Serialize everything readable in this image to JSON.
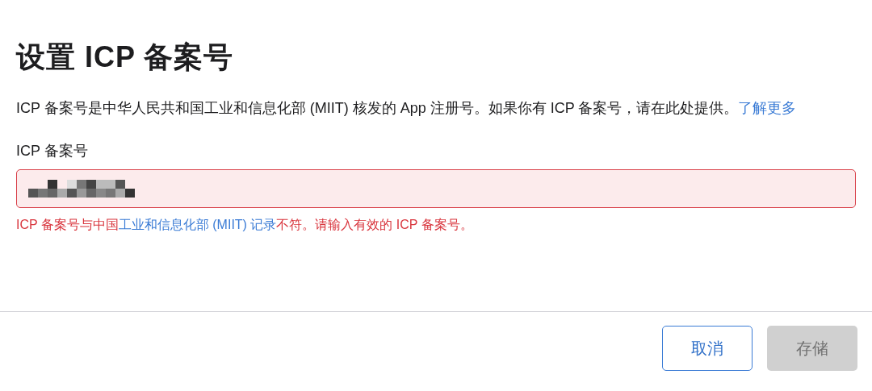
{
  "title": "设置 ICP 备案号",
  "description": [
    {
      "kind": "text",
      "text": "ICP 备案号是中华人民共和国工业和信息化部 (MIIT) 核发的 App 注册号。如果你有 ICP 备案号，请在此处提供。"
    },
    {
      "kind": "link",
      "text": "了解更多"
    }
  ],
  "field": {
    "label": "ICP 备案号",
    "invalid": true,
    "value_redacted": true
  },
  "error": [
    {
      "kind": "text",
      "text": "ICP 备案号与中国"
    },
    {
      "kind": "link",
      "text": "工业和信息化部 (MIIT) 记录"
    },
    {
      "kind": "text",
      "text": "不符。请输入有效的 ICP 备案号。"
    }
  ],
  "buttons": [
    {
      "label": "取消",
      "kind": "secondary",
      "disabled": false
    },
    {
      "label": "存储",
      "kind": "primary",
      "disabled": true
    }
  ]
}
